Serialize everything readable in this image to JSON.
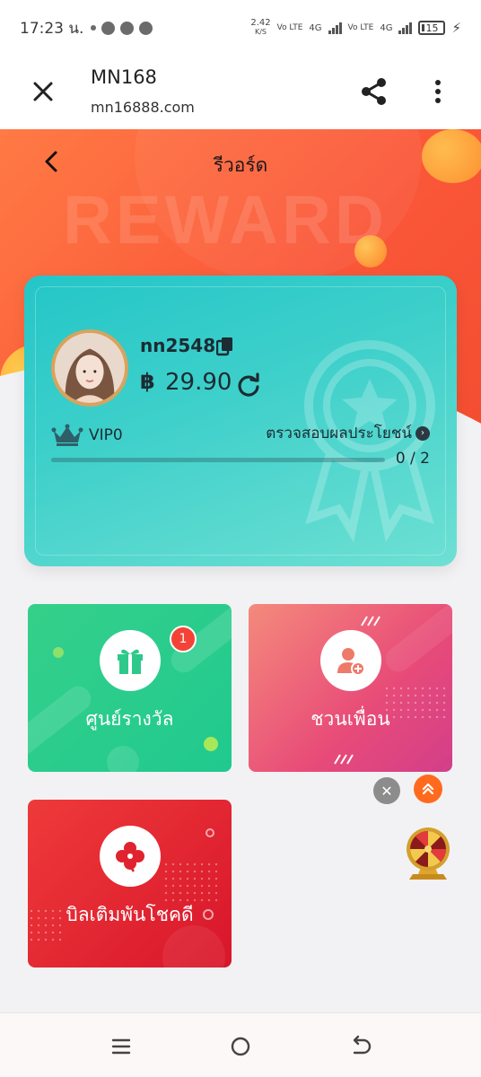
{
  "status_bar": {
    "time": "17:23 น.",
    "net_speed": "2.42",
    "net_unit": "K/S",
    "sim1": "Vo LTE",
    "sim1_net": "4G",
    "sim2": "Vo LTE",
    "sim2_net": "4G",
    "battery": "15"
  },
  "browser": {
    "title": "MN168",
    "url": "mn16888.com"
  },
  "page": {
    "title": "รีวอร์ด",
    "watermark": "REWARD"
  },
  "profile": {
    "username": "nn2548",
    "currency_symbol": "฿",
    "balance": "29.90",
    "vip_level": "VIP0",
    "benefit_link": "ตรวจสอบผลประโยชน์",
    "progress_text": "0 / 2",
    "progress_fraction": 0
  },
  "tiles": {
    "reward_center": {
      "label": "ศูนย์รางวัล",
      "badge": "1"
    },
    "invite_friend": {
      "label": "ชวนเพื่อน"
    },
    "bill_deposit": {
      "label": "บิลเติมพันโชคดี"
    }
  },
  "colors": {
    "hero_orange": "#fa5638",
    "card_teal": "#3ccfca",
    "reward_green": "#20c98f",
    "invite_pink": "#e84b78",
    "bill_red": "#d8162b",
    "badge_red": "#f44336"
  },
  "icons": {
    "close": "close-icon",
    "share": "share-icon",
    "more": "more-vertical-icon",
    "back": "chevron-left-icon",
    "copy": "copy-icon",
    "refresh": "refresh-icon",
    "crown": "crown-icon",
    "gift": "gift-icon",
    "add_user": "add-user-icon",
    "clover": "clover-icon",
    "wheel": "lucky-wheel-icon"
  }
}
